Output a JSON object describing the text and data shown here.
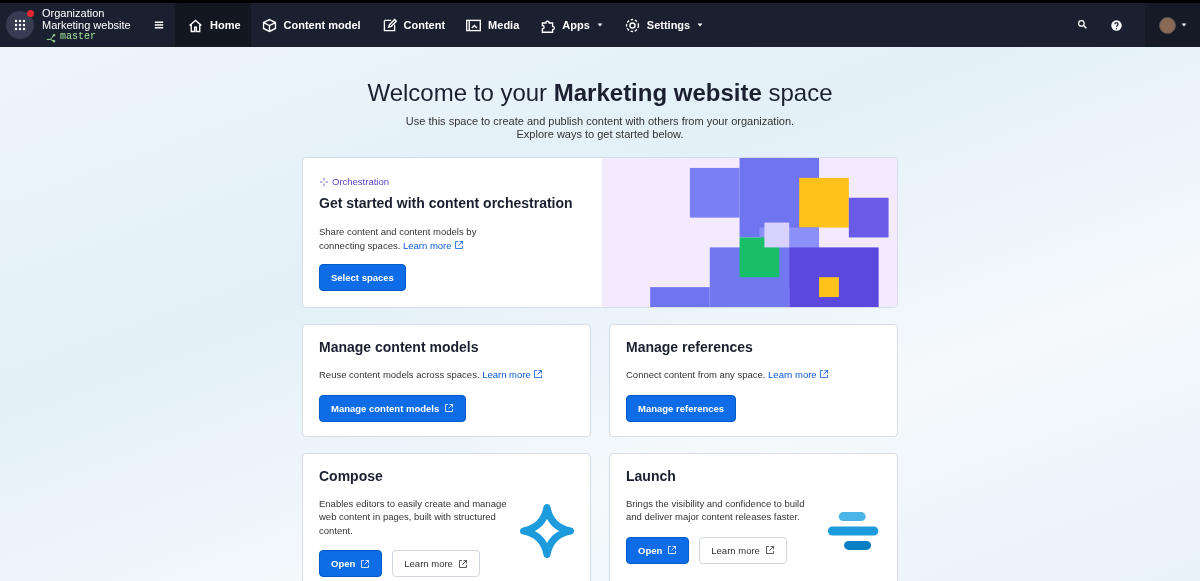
{
  "top_bar": {
    "org": "Organization",
    "space": "Marketing website",
    "environment": "master",
    "notification": true,
    "nav": [
      {
        "label": "Home",
        "selected": true,
        "dropdown": false
      },
      {
        "label": "Content model",
        "selected": false,
        "dropdown": false
      },
      {
        "label": "Content",
        "selected": false,
        "dropdown": false
      },
      {
        "label": "Media",
        "selected": false,
        "dropdown": false
      },
      {
        "label": "Apps",
        "selected": false,
        "dropdown": true
      },
      {
        "label": "Settings",
        "selected": false,
        "dropdown": true
      }
    ]
  },
  "welcome": {
    "title": "Welcome to your **Marketing website** space",
    "subtitle": "Use this space to create and publish content with others from your organization.",
    "subtitle_2": "Explore ways to get started below."
  },
  "hero": {
    "eyebrow": "Orchestration",
    "title": "Get started with content orchestration",
    "text": "Share content and content models by connecting spaces.",
    "link": "Learn more",
    "button": "Select spaces"
  },
  "cards": [
    {
      "title": "Manage content models",
      "text": "Reuse content models across spaces.",
      "link": "Learn more",
      "buttons": [
        {
          "label": "Manage content models",
          "kind": "primary",
          "external": true
        }
      ]
    },
    {
      "title": "Manage references",
      "text": "Connect content from any space.",
      "link": "Learn more",
      "buttons": [
        {
          "label": "Manage references",
          "kind": "primary",
          "external": false
        }
      ]
    },
    {
      "title": "Compose",
      "text": "Enables editors to easily create and manage web content in pages, built with structured content.",
      "buttons": [
        {
          "label": "Open",
          "kind": "primary",
          "external": true
        },
        {
          "label": "Learn more",
          "kind": "secondary",
          "external": true
        }
      ]
    },
    {
      "title": "Launch",
      "text": "Brings the visibility and confidence to build and deliver major content releases faster.",
      "buttons": [
        {
          "label": "Open",
          "kind": "primary",
          "external": true
        },
        {
          "label": "Learn more",
          "kind": "secondary",
          "external": true
        }
      ]
    }
  ]
}
